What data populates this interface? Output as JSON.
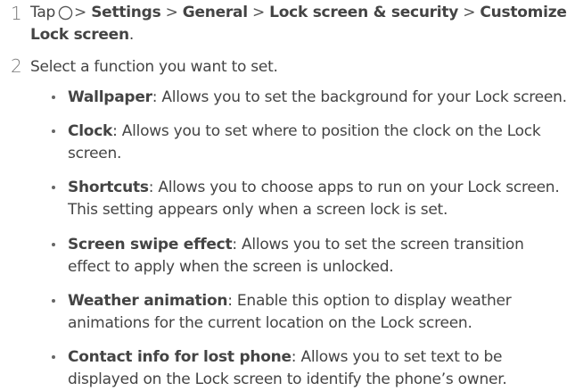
{
  "step1": {
    "number": "1",
    "tap": "Tap",
    "separator": ">",
    "path": [
      "Settings",
      "General",
      "Lock screen & security",
      "Customize Lock screen"
    ],
    "period": ".",
    "home_icon": "home-circle-icon"
  },
  "step2": {
    "number": "2",
    "text": "Select a function you want to set."
  },
  "options": [
    {
      "name": "Wallpaper",
      "desc": "Allows you to set the background for your Lock screen."
    },
    {
      "name": "Clock",
      "desc": "Allows you to set where to position the clock on the Lock screen."
    },
    {
      "name": "Shortcuts",
      "desc": "Allows you to choose apps to run on your Lock screen. This setting appears only when a screen lock is set."
    },
    {
      "name": "Screen swipe effect",
      "desc": "Allows you to set the screen transition effect to apply when the screen is unlocked."
    },
    {
      "name": "Weather animation",
      "desc": "Enable this option to display weather animations for the current location on the Lock screen."
    },
    {
      "name": "Contact info for lost phone",
      "desc": "Allows you to set text to be displayed on the Lock screen to identify the phone’s owner."
    }
  ],
  "colors": {
    "text": "#444444",
    "step_number": "#777777"
  }
}
